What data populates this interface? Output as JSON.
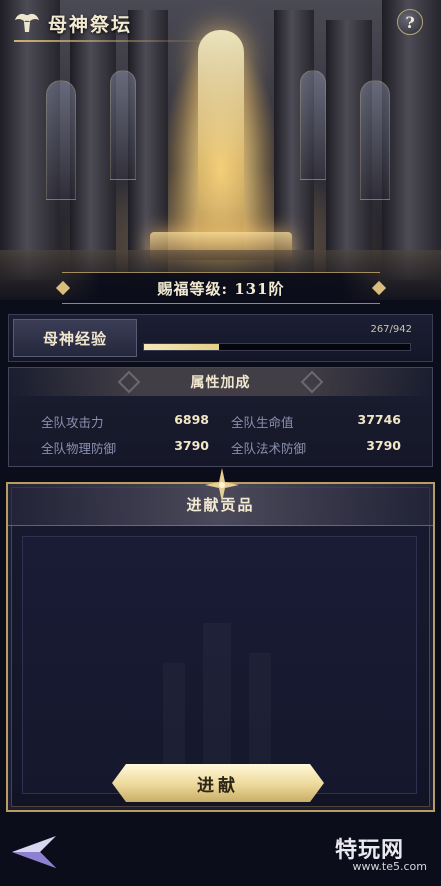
{
  "header": {
    "title": "母神祭坛",
    "help_label": "?"
  },
  "level": {
    "text": "赐福等级: 131阶"
  },
  "experience": {
    "label": "母神经验",
    "current": 267,
    "max": 942,
    "display": "267/942"
  },
  "attributes": {
    "title": "属性加成",
    "stats": [
      {
        "name": "全队攻击力",
        "value": "6898"
      },
      {
        "name": "全队生命值",
        "value": "37746"
      },
      {
        "name": "全队物理防御",
        "value": "3790"
      },
      {
        "name": "全队法术防御",
        "value": "3790"
      }
    ]
  },
  "tribute": {
    "title": "进献贡品",
    "button_label": "进献"
  },
  "watermark": {
    "main": "特玩网",
    "sub": "www.te5.com"
  },
  "colors": {
    "accent_gold": "#d8bd7e",
    "button_gold": "#ecd89a",
    "panel_bg": "#151728"
  },
  "icons": [
    "angel-emblem-icon",
    "help-icon",
    "back-arrow-icon"
  ]
}
